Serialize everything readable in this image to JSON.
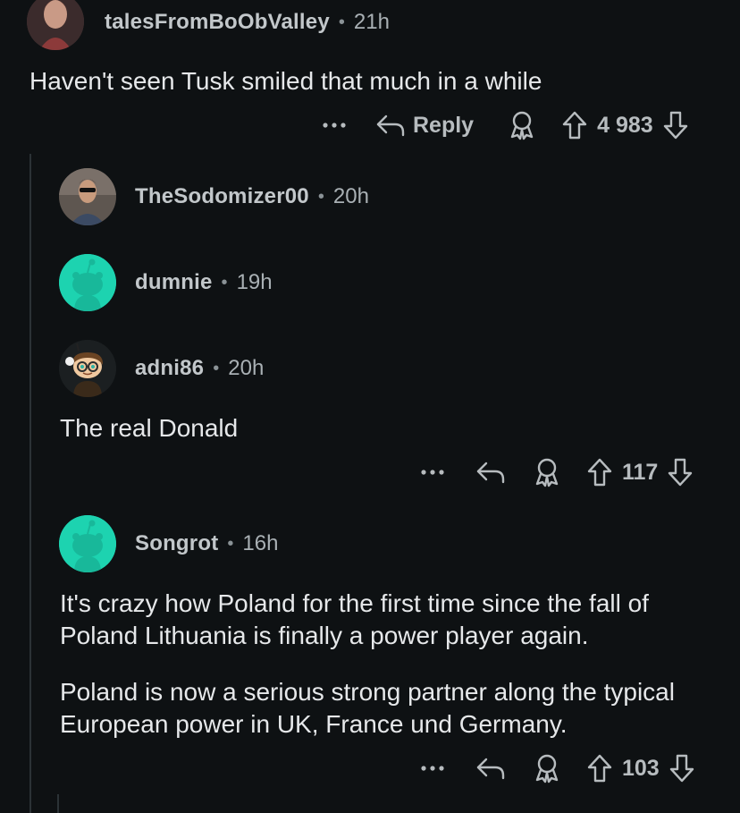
{
  "comments": [
    {
      "username": "talesFromBoObValley",
      "time": "21h",
      "text": "Haven't seen Tusk smiled that much in a while",
      "reply_label": "Reply",
      "score": "4 983"
    },
    {
      "username": "TheSodomizer00",
      "time": "20h"
    },
    {
      "username": "dumnie",
      "time": "19h"
    },
    {
      "username": "adni86",
      "time": "20h",
      "text": "The real Donald",
      "score": "117"
    },
    {
      "username": "Songrot",
      "time": "16h",
      "paragraphs": [
        "It's crazy how Poland for the first time since the fall of Poland Lithuania is finally a power player again.",
        "Poland is now a serious strong partner along the typical European power in UK, France und Germany."
      ],
      "score": "103"
    }
  ],
  "separator": "•",
  "icons": {
    "more": "more-options-icon",
    "reply": "reply-arrow-icon",
    "award": "award-icon",
    "upvote": "upvote-arrow-icon",
    "downvote": "downvote-arrow-icon"
  },
  "colors": {
    "background": "#0e1113",
    "default_avatar": "#1dd3b0"
  }
}
